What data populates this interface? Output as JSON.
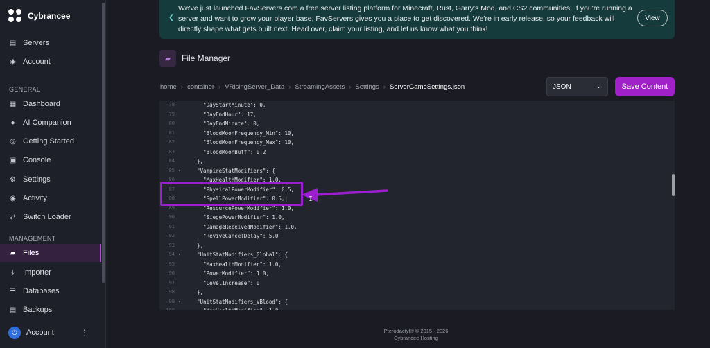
{
  "brand": {
    "name": "Cybrancee"
  },
  "sidebar": {
    "top_items": [
      {
        "label": "Servers",
        "icon": "server-icon"
      },
      {
        "label": "Account",
        "icon": "user-circle-icon"
      }
    ],
    "general_label": "GENERAL",
    "general_items": [
      {
        "label": "Dashboard",
        "icon": "grid-icon"
      },
      {
        "label": "AI Companion",
        "icon": "chat-icon"
      },
      {
        "label": "Getting Started",
        "icon": "compass-icon"
      },
      {
        "label": "Console",
        "icon": "terminal-icon"
      },
      {
        "label": "Settings",
        "icon": "gear-icon"
      },
      {
        "label": "Activity",
        "icon": "eye-icon"
      },
      {
        "label": "Switch Loader",
        "icon": "swap-icon"
      }
    ],
    "management_label": "MANAGEMENT",
    "management_items": [
      {
        "label": "Files",
        "icon": "folder-icon",
        "active": true
      },
      {
        "label": "Importer",
        "icon": "download-icon"
      },
      {
        "label": "Databases",
        "icon": "database-icon"
      },
      {
        "label": "Backups",
        "icon": "archive-icon"
      }
    ],
    "account_label": "Account"
  },
  "banner": {
    "text": "We've just launched FavServers.com a free server listing platform for Minecraft, Rust, Garry's Mod, and CS2 communities. If you're running a server and want to grow your player base, FavServers gives you a place to get discovered. We're in early release, so your feedback will directly shape what gets built next. Head over, claim your listing, and let us know what you think!",
    "button": "View"
  },
  "page_title": "File Manager",
  "breadcrumb": [
    "home",
    "container",
    "VRisingServer_Data",
    "StreamingAssets",
    "Settings",
    "ServerGameSettings.json"
  ],
  "format_select": {
    "value": "JSON"
  },
  "save_button": "Save Content",
  "editor": {
    "lines": [
      {
        "n": "78",
        "fold": "",
        "code": "    \"DayStartMinute\": 0,"
      },
      {
        "n": "79",
        "fold": "",
        "code": "    \"DayEndHour\": 17,"
      },
      {
        "n": "80",
        "fold": "",
        "code": "    \"DayEndMinute\": 0,"
      },
      {
        "n": "81",
        "fold": "",
        "code": "    \"BloodMoonFrequency_Min\": 10,"
      },
      {
        "n": "82",
        "fold": "",
        "code": "    \"BloodMoonFrequency_Max\": 10,"
      },
      {
        "n": "83",
        "fold": "",
        "code": "    \"BloodMoonBuff\": 0.2"
      },
      {
        "n": "84",
        "fold": "",
        "code": "  },"
      },
      {
        "n": "85",
        "fold": "▾",
        "code": "  \"VampireStatModifiers\": {"
      },
      {
        "n": "86",
        "fold": "",
        "code": "    \"MaxHealthModifier\": 1.0,"
      },
      {
        "n": "87",
        "fold": "",
        "code": "    \"PhysicalPowerModifier\": 0.5,"
      },
      {
        "n": "88",
        "fold": "",
        "code": "    \"SpellPowerModifier\": 0.5,|"
      },
      {
        "n": "89",
        "fold": "",
        "code": "    \"ResourcePowerModifier\": 1.0,"
      },
      {
        "n": "90",
        "fold": "",
        "code": "    \"SiegePowerModifier\": 1.0,"
      },
      {
        "n": "91",
        "fold": "",
        "code": "    \"DamageReceivedModifier\": 1.0,"
      },
      {
        "n": "92",
        "fold": "",
        "code": "    \"ReviveCancelDelay\": 5.0"
      },
      {
        "n": "93",
        "fold": "",
        "code": "  },"
      },
      {
        "n": "94",
        "fold": "▾",
        "code": "  \"UnitStatModifiers_Global\": {"
      },
      {
        "n": "95",
        "fold": "",
        "code": "    \"MaxHealthModifier\": 1.0,"
      },
      {
        "n": "96",
        "fold": "",
        "code": "    \"PowerModifier\": 1.0,"
      },
      {
        "n": "97",
        "fold": "",
        "code": "    \"LevelIncrease\": 0"
      },
      {
        "n": "98",
        "fold": "",
        "code": "  },"
      },
      {
        "n": "99",
        "fold": "▾",
        "code": "  \"UnitStatModifiers_VBlood\": {"
      },
      {
        "n": "100",
        "fold": "",
        "code": "    \"MaxHealthModifier\": 1.0"
      }
    ]
  },
  "footer": {
    "line1": "Pterodactyl® © 2015 - 2026",
    "line2": "Cybrancee Hosting"
  },
  "colors": {
    "accent": "#a021c8",
    "annotation": "#9b1fd1",
    "banner_bg": "#163b3c",
    "active_bg": "#34203f"
  }
}
